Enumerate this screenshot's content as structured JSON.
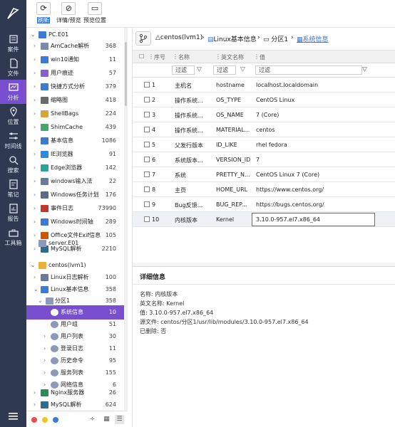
{
  "nav": [
    {
      "label": "案件",
      "icon": "case-icon"
    },
    {
      "label": "文件",
      "icon": "file-icon"
    },
    {
      "label": "分析",
      "icon": "analysis-icon"
    },
    {
      "label": "位置",
      "icon": "location-icon"
    },
    {
      "label": "时间线",
      "icon": "timeline-icon"
    },
    {
      "label": "搜索",
      "icon": "search-icon"
    },
    {
      "label": "笔记",
      "icon": "note-icon"
    },
    {
      "label": "报告",
      "icon": "report-icon"
    },
    {
      "label": "工具箱",
      "icon": "toolbox-icon"
    }
  ],
  "toolbar": {
    "refresh": "刷新",
    "preview": "详情/预览",
    "preview_pos": "预览位置"
  },
  "tree": {
    "pc": "PC.E01",
    "pc_items": [
      {
        "label": "AmCache解析",
        "count": "368",
        "color": "#7a8aa8"
      },
      {
        "label": "win10通知",
        "count": "11",
        "color": "#3a7bd5"
      },
      {
        "label": "用户痕迹",
        "count": "57",
        "color": "#8a5fd0"
      },
      {
        "label": "快捷方式分析",
        "count": "379",
        "color": "#3a7bd5"
      },
      {
        "label": "缩略图",
        "count": "418",
        "color": "#6a6a6a"
      },
      {
        "label": "ShellBags",
        "count": "224",
        "color": "#d9a53a"
      },
      {
        "label": "ShimCache",
        "count": "439",
        "color": "#4aa36a"
      },
      {
        "label": "基本信息",
        "count": "1086",
        "color": "#3a7bd5"
      },
      {
        "label": "IE浏览器",
        "count": "91",
        "color": "#2a8be0"
      },
      {
        "label": "Edge浏览器",
        "count": "142",
        "color": "#2aa39a"
      },
      {
        "label": "windows输入法",
        "count": "22",
        "color": "#6a7a9a"
      },
      {
        "label": "Windows任务计划",
        "count": "176",
        "color": "#5a6a8a"
      },
      {
        "label": "事件日志",
        "count": "73990",
        "color": "#c0392b"
      },
      {
        "label": "Windows时间轴",
        "count": "289",
        "color": "#3a7bd5"
      },
      {
        "label": "Office文件Exif信息",
        "count": "105",
        "color": "#d35400"
      },
      {
        "label": "MySQL解析",
        "count": "2210",
        "color": "#2e6d8e"
      }
    ],
    "server": "server.E01",
    "centos": "centos(lvm1)",
    "linux_log": {
      "label": "Linux日志解析",
      "count": "100"
    },
    "linux_basic": {
      "label": "Linux基本信息",
      "count": "358"
    },
    "partition": {
      "label": "分区1",
      "count": "358"
    },
    "sub_items": [
      {
        "label": "系统信息",
        "count": "10",
        "color": "#ffffff"
      },
      {
        "label": "用户组",
        "count": "51",
        "color": "#8a9ab8"
      },
      {
        "label": "用户列表",
        "count": "30",
        "color": "#8a9ab8"
      },
      {
        "label": "登录日志",
        "count": "11",
        "color": "#8a9ab8"
      },
      {
        "label": "历史命令",
        "count": "95",
        "color": "#8a9ab8"
      },
      {
        "label": "服务列表",
        "count": "155",
        "color": "#8a9ab8"
      },
      {
        "label": "网络信息",
        "count": "6",
        "color": "#8a9ab8"
      }
    ],
    "nginx": {
      "label": "Nginx服务器",
      "count": "26"
    },
    "mysql": {
      "label": "MySQL解析",
      "count": "624"
    }
  },
  "breadcrumb": [
    "centos(lvm1)",
    "Linux基本信息",
    "分区1",
    "系统信息"
  ],
  "grid": {
    "headers": [
      "序号",
      "名称",
      "英文名称",
      "值"
    ],
    "filter": "过滤",
    "rows": [
      {
        "no": "1",
        "name": "主机名",
        "en": "hostname",
        "val": "localhost.localdomain"
      },
      {
        "no": "2",
        "name": "操作系统...",
        "en": "OS_TYPE",
        "val": "CentOS Linux"
      },
      {
        "no": "3",
        "name": "操作系统...",
        "en": "OS_NAME",
        "val": "7 (Core)"
      },
      {
        "no": "4",
        "name": "操作系统...",
        "en": "MATERIAL...",
        "val": "centos"
      },
      {
        "no": "5",
        "name": "父发行版本",
        "en": "ID_LIKE",
        "val": "rhel fedora"
      },
      {
        "no": "6",
        "name": "系统版本...",
        "en": "VERSION_ID",
        "val": "7"
      },
      {
        "no": "7",
        "name": "系统",
        "en": "PRETTY_N...",
        "val": "CentOS Linux 7 (Core)"
      },
      {
        "no": "8",
        "name": "主页",
        "en": "HOME_URL",
        "val": "https://www.centos.org/"
      },
      {
        "no": "9",
        "name": "Bug反馈...",
        "en": "BUG_REP...",
        "val": "https://bugs.centos.org/"
      },
      {
        "no": "10",
        "name": "内核版本",
        "en": "Kernel",
        "val": "3.10.0-957.el7.x86_64"
      }
    ]
  },
  "detail": {
    "title": "详细信息",
    "lines": [
      "名称: 内核版本",
      "英文名称: Kernel",
      "值: 3.10.0-957.el7.x86_64",
      "源文件: centos/分区1/usr/lib/modules/3.10.0-957.el7.x86_64",
      "已删除: 否"
    ]
  }
}
